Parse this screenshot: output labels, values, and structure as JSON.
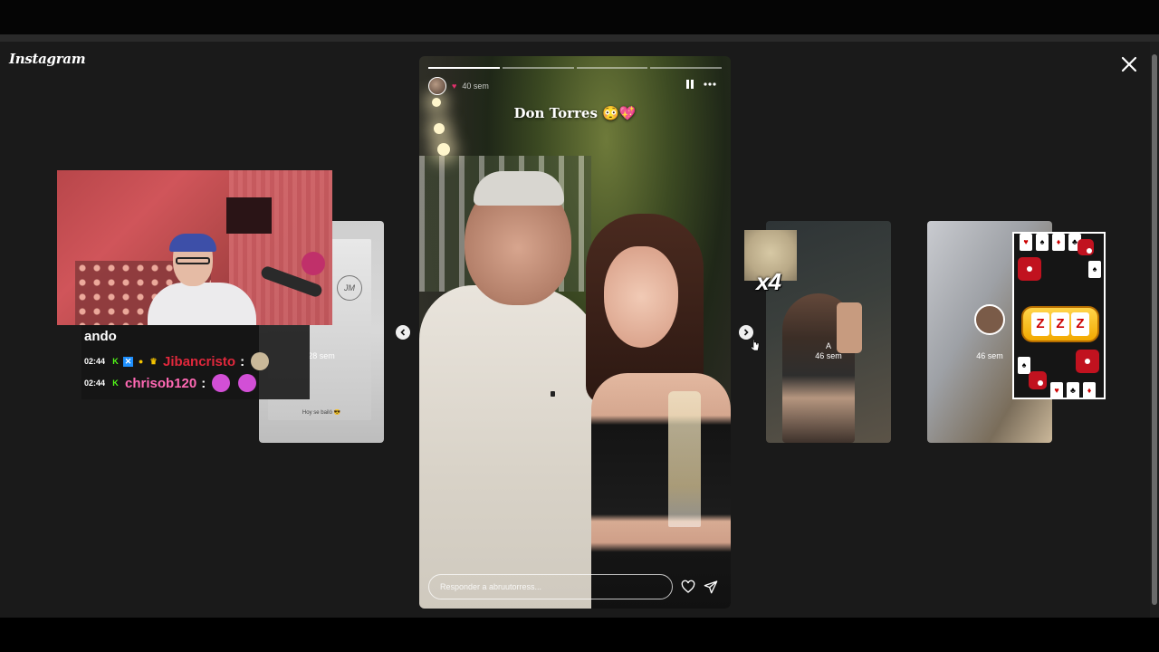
{
  "app": {
    "logo": "Instagram"
  },
  "colors": {
    "background": "#1a1a1a",
    "accent": "#e1306c",
    "chat_name_1": "#e0283c",
    "chat_name_2": "#ff69b4"
  },
  "story": {
    "progress": {
      "segments": 4,
      "current": 1
    },
    "badge": "♥",
    "time": "40 sem",
    "title": "Don Torres 😳💖",
    "reply_placeholder": "Responder a abruutorress...",
    "icons": {
      "pause": "pause-icon",
      "more": "more-icon",
      "like": "heart-icon",
      "send": "send-icon"
    }
  },
  "side_cards": {
    "left": {
      "time": "28 sem",
      "caption": "Hoy se bailó 😎"
    },
    "mid": {
      "handle": "A",
      "time": "46 sem"
    },
    "right": {
      "time": "46 sem"
    }
  },
  "overlay": {
    "chat_title": "ando",
    "messages": [
      {
        "time": "02:44",
        "user": "Jibancristo",
        "colon": ":"
      },
      {
        "time": "02:44",
        "user": "chrisob120",
        "colon": ":"
      }
    ],
    "multiplier": "x4",
    "slot_symbol": "Z"
  }
}
